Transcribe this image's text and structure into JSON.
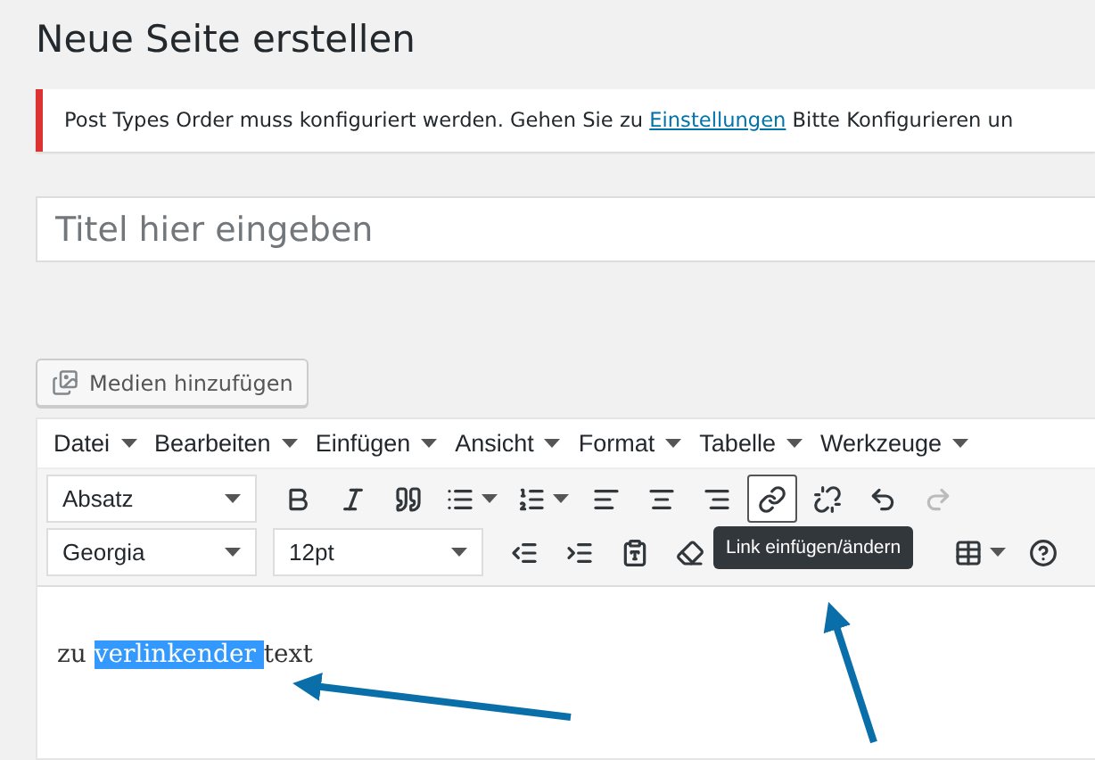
{
  "page_title": "Neue Seite erstellen",
  "notice": {
    "text_before": "Post Types Order muss konfiguriert werden. Gehen Sie zu ",
    "link": "Einstellungen",
    "text_after": " Bitte Konfigurieren un"
  },
  "title_field": {
    "placeholder": "Titel hier eingeben"
  },
  "media_button": "Medien hinzufügen",
  "menu": [
    "Datei",
    "Bearbeiten",
    "Einfügen",
    "Ansicht",
    "Format",
    "Tabelle",
    "Werkzeuge"
  ],
  "toolbar_row_1": [
    {
      "kind": "select",
      "value": "Absatz"
    },
    {
      "kind": "button",
      "selected": false,
      "disabled": false
    },
    {
      "kind": "button",
      "selected": false,
      "disabled": false
    },
    {
      "kind": "button",
      "selected": false,
      "disabled": false
    },
    {
      "kind": "split",
      "selected": false,
      "disabled": false
    },
    {
      "kind": "split",
      "selected": false,
      "disabled": false
    },
    {
      "kind": "button",
      "selected": false,
      "disabled": false
    },
    {
      "kind": "button",
      "selected": false,
      "disabled": false
    },
    {
      "kind": "button",
      "selected": false,
      "disabled": false
    },
    {
      "kind": "button",
      "selected": true,
      "disabled": false
    },
    {
      "kind": "button",
      "selected": false,
      "disabled": false
    },
    {
      "kind": "button",
      "selected": false,
      "disabled": false
    },
    {
      "kind": "button",
      "selected": false,
      "disabled": true
    }
  ],
  "toolbar_row_2": [
    {
      "kind": "select",
      "value": "Georgia"
    },
    {
      "kind": "select",
      "value": "12pt"
    },
    {
      "kind": "button",
      "selected": false,
      "disabled": false
    },
    {
      "kind": "button",
      "selected": false,
      "disabled": false
    },
    {
      "kind": "button",
      "selected": false,
      "disabled": false
    },
    {
      "kind": "button",
      "selected": false,
      "disabled": false
    },
    {
      "kind": "gap"
    },
    {
      "kind": "split",
      "selected": false,
      "disabled": false
    },
    {
      "kind": "button",
      "selected": false,
      "disabled": false
    }
  ],
  "tooltip": "Link einfügen/ändern",
  "content": [
    {
      "text": "zu ",
      "selected": false
    },
    {
      "text": "verlinkender ",
      "selected": true
    },
    {
      "text": "text",
      "selected": false
    }
  ]
}
